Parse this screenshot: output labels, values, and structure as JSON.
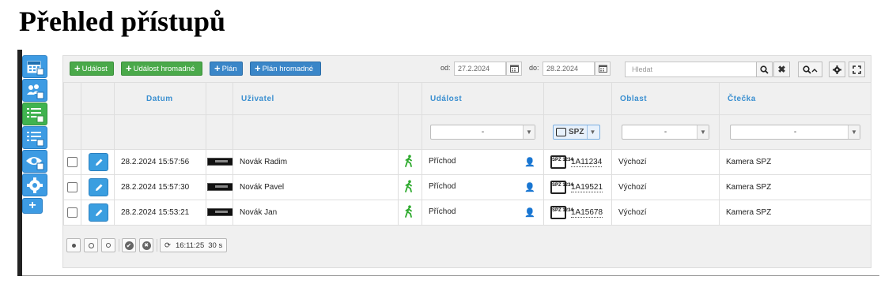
{
  "page": {
    "title": "Přehled přístupů"
  },
  "sidebar": {
    "items": [
      {
        "icon": "calendar-icon",
        "active": false
      },
      {
        "icon": "users-icon",
        "active": false
      },
      {
        "icon": "list-icon",
        "active": true
      },
      {
        "icon": "list-detail-icon",
        "active": false
      },
      {
        "icon": "eye-icon",
        "active": false
      },
      {
        "icon": "gear-icon",
        "active": false
      }
    ],
    "add_label": "+"
  },
  "toolbar": {
    "btn_event": "Událost",
    "btn_event_bulk": "Událost hromadné",
    "btn_plan": "Plán",
    "btn_plan_bulk": "Plán hromadné",
    "from_label": "od:",
    "from_value": "27.2.2024",
    "to_label": "do:",
    "to_value": "28.2.2024",
    "search_placeholder": "Hledat"
  },
  "columns": {
    "date": "Datum",
    "user": "Uživatel",
    "event": "Událost",
    "area": "Oblast",
    "reader": "Čtečka"
  },
  "filters": {
    "event": "-",
    "plate": "SPZ",
    "area": "-",
    "reader": "-"
  },
  "plate_icon_text": "SPZ 1234",
  "rows": [
    {
      "datetime": "28.2.2024 15:57:56",
      "user": "Novák Radim",
      "event": "Příchod",
      "plate": "1A11234",
      "area": "Výchozí",
      "reader": "Kamera SPZ"
    },
    {
      "datetime": "28.2.2024 15:57:30",
      "user": "Novák Pavel",
      "event": "Příchod",
      "plate": "1A19521",
      "area": "Výchozí",
      "reader": "Kamera SPZ"
    },
    {
      "datetime": "28.2.2024 15:53:21",
      "user": "Novák Jan",
      "event": "Příchod",
      "plate": "1A15678",
      "area": "Výchozí",
      "reader": "Kamera SPZ"
    }
  ],
  "footer": {
    "clock": "16:11:25",
    "interval": "30 s"
  },
  "colors": {
    "accent_blue": "#3a8fd0",
    "green": "#4aa94a",
    "sidebar_blue": "#3d9be3"
  }
}
